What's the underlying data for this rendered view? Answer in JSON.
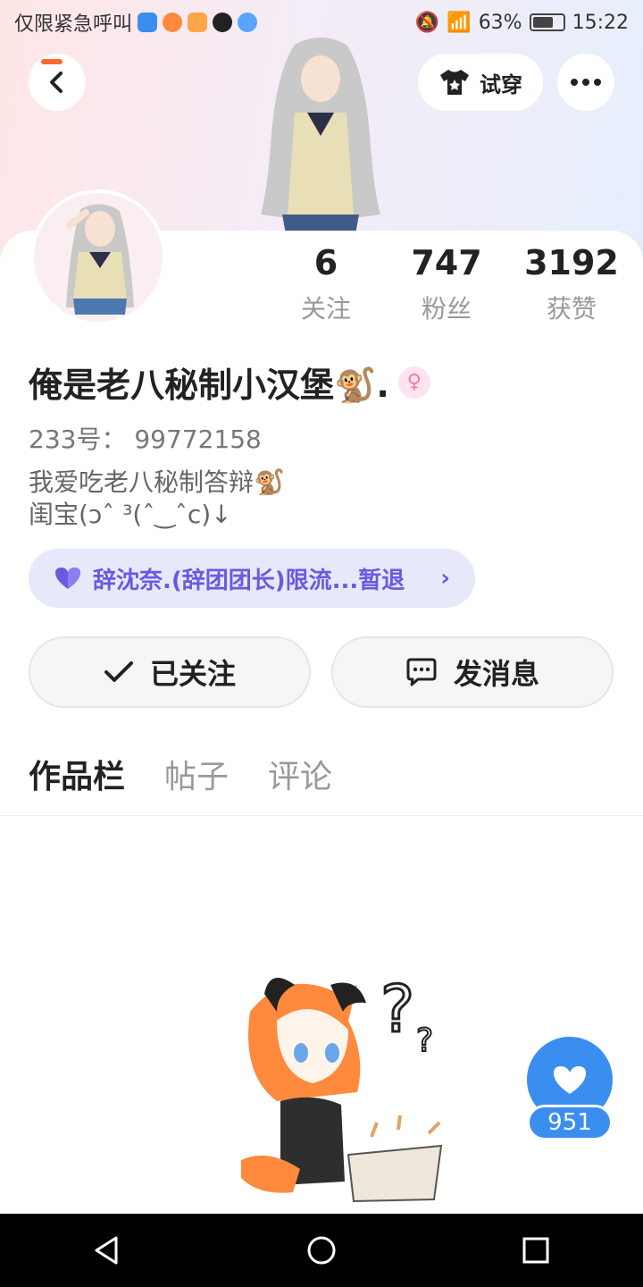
{
  "status_bar": {
    "left_text": "仅限紧急呼叫",
    "battery": "63%",
    "time": "15:22"
  },
  "header": {
    "tryon_label": "试穿"
  },
  "stats": [
    {
      "value": "6",
      "label": "关注"
    },
    {
      "value": "747",
      "label": "粉丝"
    },
    {
      "value": "3192",
      "label": "获赞"
    }
  ],
  "profile": {
    "username": "俺是老八秘制小汉堡🐒.",
    "gender": "♀",
    "uid": "233号： 99772158",
    "bio_line1": "我爱吃老八秘制答辩🐒",
    "bio_line2": "闺宝(ɔˆ ³(ˆ‿ˆc)↓"
  },
  "group": {
    "label": "辞沈奈.(辞团团长)限流...暂退"
  },
  "actions": {
    "follow_label": "已关注",
    "message_label": "发消息"
  },
  "tabs": [
    {
      "label": "作品栏",
      "active": true
    },
    {
      "label": "帖子",
      "active": false
    },
    {
      "label": "评论",
      "active": false
    }
  ],
  "like": {
    "count": "951"
  },
  "colors": {
    "accent_orange": "#ff6a2b",
    "like_blue": "#3a8ef0",
    "group_purple": "#6a5adf"
  }
}
